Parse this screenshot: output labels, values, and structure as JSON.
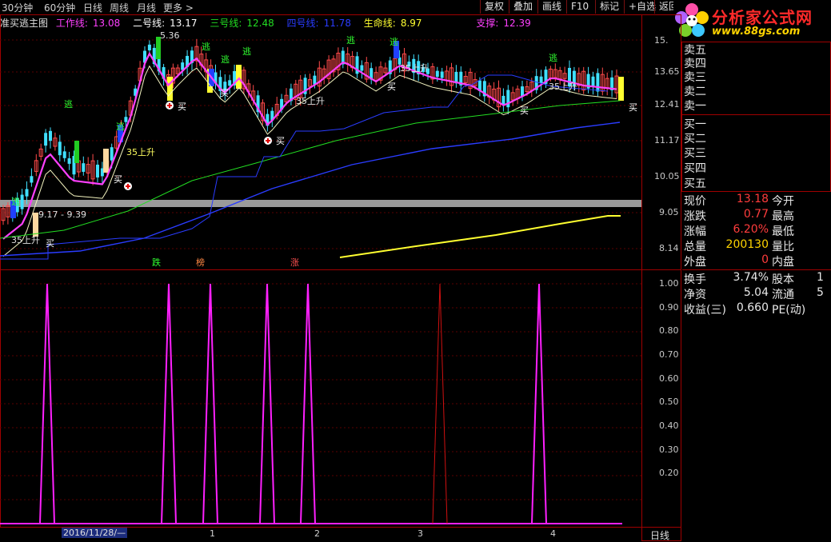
{
  "toolbar": {
    "periods": [
      "30分钟",
      "60分钟",
      "日线",
      "周线",
      "月线",
      "更多 >"
    ],
    "buttons": [
      "复权",
      "叠加",
      "画线",
      "F10",
      "标记",
      "+自选",
      "返回"
    ]
  },
  "logo": {
    "name": "分析家公式网",
    "url": "www.88gs.com"
  },
  "legend": {
    "title": "准买逃主图",
    "items": [
      {
        "label": "工作线:",
        "value": "13.08",
        "color": "#ff40ff"
      },
      {
        "label": "二号线:",
        "value": "13.17",
        "color": "#ffffff"
      },
      {
        "label": "三号线:",
        "value": "12.48",
        "color": "#22dd22"
      },
      {
        "label": "四号线:",
        "value": "11.78",
        "color": "#2a3cff"
      },
      {
        "label": "生命线:",
        "value": "8.97",
        "color": "#ffff30"
      },
      {
        "label": "支撑:",
        "value": "12.39",
        "color": "#ff40ff"
      }
    ]
  },
  "main_axis": {
    "labels": [
      "15.",
      "13.65",
      "12.41",
      "11.17",
      "10.05",
      "9.05",
      "8.14"
    ]
  },
  "indicator_axis": {
    "labels": [
      "1.00",
      "0.90",
      "0.80",
      "0.70",
      "0.60",
      "0.50",
      "0.40",
      "0.30",
      "0.20"
    ]
  },
  "annotations": {
    "high_label": "5.36",
    "range_label": "9.17 - 9.39",
    "buy": "买",
    "escape": "逃",
    "rise": "35上升",
    "rise2": "35上升",
    "markers": [
      "跌",
      "榜",
      "涨"
    ]
  },
  "quote": {
    "sell": [
      "卖五",
      "卖四",
      "卖三",
      "卖二",
      "卖一"
    ],
    "buy": [
      "买一",
      "买二",
      "买三",
      "买四",
      "买五"
    ],
    "rows": [
      {
        "l1": "现价",
        "v1": "13.18",
        "c1": "#ff3c3c",
        "l2": "今开",
        "v2": ""
      },
      {
        "l1": "涨跌",
        "v1": "0.77",
        "c1": "#ff3c3c",
        "l2": "最高",
        "v2": ""
      },
      {
        "l1": "涨幅",
        "v1": "6.20%",
        "c1": "#ff3c3c",
        "l2": "最低",
        "v2": ""
      },
      {
        "l1": "总量",
        "v1": "200130",
        "c1": "#ffd400",
        "l2": "量比",
        "v2": ""
      },
      {
        "l1": "外盘",
        "v1": "0",
        "c1": "#ff3c3c",
        "l2": "内盘",
        "v2": ""
      },
      {
        "l1": "换手",
        "v1": "3.74%",
        "c1": "#e8e8e8",
        "l2": "股本",
        "v2": "1"
      },
      {
        "l1": "净资",
        "v1": "5.04",
        "c1": "#e8e8e8",
        "l2": "流通",
        "v2": "5"
      },
      {
        "l1": "收益(三)",
        "v1": "0.660",
        "c1": "#e8e8e8",
        "l2": "PE(动)",
        "v2": ""
      }
    ]
  },
  "xaxis": {
    "date": "2016/11/28/—",
    "months": [
      "1",
      "2",
      "3",
      "4"
    ],
    "period": "日线"
  },
  "colors": {
    "bg": "#000000",
    "frame": "#a00000",
    "up": "#ff4a4a",
    "down": "#40e0ff",
    "signal": "#ff20ff"
  },
  "chart_data": {
    "type": "line",
    "ylim": [
      0,
      1
    ],
    "series": [
      {
        "name": "",
        "values": [
          0,
          0,
          1,
          0,
          0,
          1,
          0,
          1,
          0,
          0,
          1,
          0,
          1,
          0,
          0,
          1,
          0,
          0,
          1,
          0,
          0
        ]
      }
    ]
  }
}
